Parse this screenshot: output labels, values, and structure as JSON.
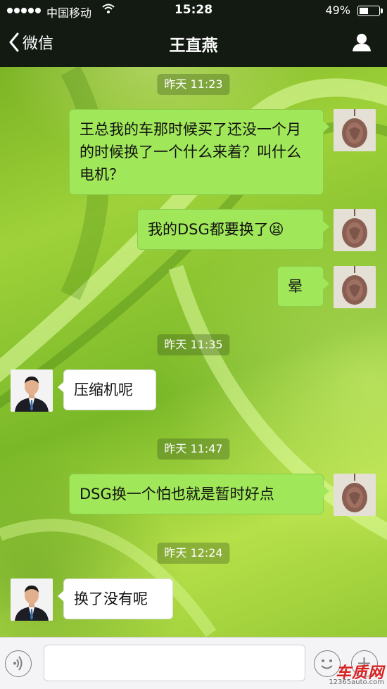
{
  "status_bar": {
    "carrier": "中国移动",
    "time": "15:28",
    "battery_percent": "49%",
    "battery_level": 0.49
  },
  "nav": {
    "back_label": "微信",
    "title": "王直燕",
    "back_icon": "chevron-left-icon",
    "contact_icon": "person-icon"
  },
  "messages": [
    {
      "type": "time",
      "text": "昨天 11:23"
    },
    {
      "type": "msg",
      "sender": "self",
      "text": "王总我的车那时候买了还没一个月的时候换了一个什么来着？叫什么电机？"
    },
    {
      "type": "msg",
      "sender": "self",
      "text": "我的DSG都要换了😫"
    },
    {
      "type": "msg",
      "sender": "self",
      "text": "晕"
    },
    {
      "type": "time",
      "text": "昨天 11:35"
    },
    {
      "type": "msg",
      "sender": "other",
      "text": "压缩机呢"
    },
    {
      "type": "time",
      "text": "昨天 11:47"
    },
    {
      "type": "msg",
      "sender": "self",
      "text": "DSG换一个怕也就是暂时好点"
    },
    {
      "type": "time",
      "text": "昨天 12:24"
    },
    {
      "type": "msg",
      "sender": "other",
      "text": "换了没有呢"
    }
  ],
  "input_bar": {
    "voice_icon": "voice-icon",
    "emoji_icon": "emoji-icon",
    "plus_icon": "plus-icon",
    "placeholder": ""
  },
  "watermark": {
    "logo": "车质网",
    "url": "12365auto.com"
  },
  "colors": {
    "self_bubble": "#a0e759",
    "other_bubble": "#ffffff",
    "topbar": "#121a12"
  }
}
